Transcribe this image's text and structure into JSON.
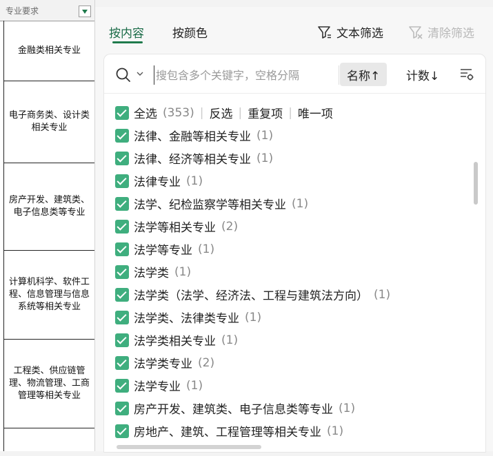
{
  "sheet": {
    "header": "专业要求",
    "cells": [
      "金融类相关专业",
      "电子商务类、设计类相关专业",
      "房产开发、建筑类、电子信息类等专业",
      "计算机科学、软件工程、信息管理与信息系统等相关专业",
      "工程类、供应链管理、物流管理、工商管理等相关专业"
    ]
  },
  "panel": {
    "tabs": [
      "按内容",
      "按颜色"
    ],
    "text_filter_label": "文本筛选",
    "clear_filter_label": "清除筛选",
    "search": {
      "placeholder": "搜包含多个关键字，空格分隔"
    },
    "sort_name_label": "名称↑",
    "sort_count_label": "计数↓",
    "select_all": {
      "label": "全选",
      "count": "(353)"
    },
    "actions": [
      "反选",
      "重复项",
      "唯一项"
    ],
    "items": [
      {
        "label": "法律、金融等相关专业",
        "count": "(1)"
      },
      {
        "label": "法律、经济等相关专业",
        "count": "(1)"
      },
      {
        "label": "法律专业",
        "count": "(1)"
      },
      {
        "label": "法学、纪检监察学等相关专业",
        "count": "(1)"
      },
      {
        "label": "法学等相关专业",
        "count": "(2)"
      },
      {
        "label": "法学等专业",
        "count": "(1)"
      },
      {
        "label": "法学类",
        "count": "(1)"
      },
      {
        "label": "法学类（法学、经济法、工程与建筑法方向）",
        "count": "(1)"
      },
      {
        "label": "法学类、法律类专业",
        "count": "(1)"
      },
      {
        "label": "法学类相关专业",
        "count": "(1)"
      },
      {
        "label": "法学类专业",
        "count": "(2)"
      },
      {
        "label": "法学专业",
        "count": "(1)"
      },
      {
        "label": "房产开发、建筑类、电子信息类等专业",
        "count": "(1)"
      },
      {
        "label": "房地产、建筑、工程管理等相关专业",
        "count": "(1)"
      }
    ],
    "colors": {
      "accent": "#1f7a4c",
      "checkbox": "#3fae7e"
    }
  }
}
